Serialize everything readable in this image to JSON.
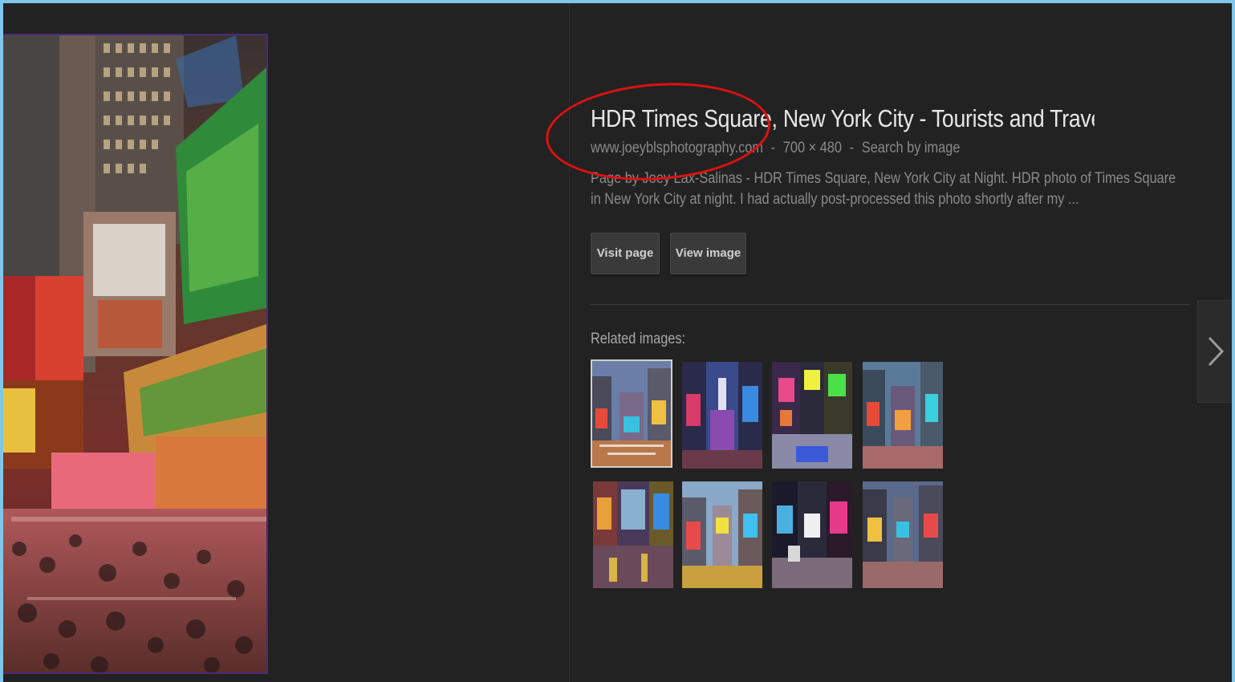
{
  "result": {
    "title": "HDR Times Square, New York City - Tourists and Traveler",
    "title_ellipsis": "...",
    "source_domain": "www.joeyblsphotography.com",
    "dimensions": "700 × 480",
    "meta_separator": "-",
    "search_by_image": "Search by image",
    "description": "Page by Joey Lax-Salinas - HDR Times Square, New York City at Night. HDR photo of Times Square in New York City at night. I had actually post-processed this photo shortly after my ..."
  },
  "buttons": {
    "visit_page": "Visit page",
    "view_image": "View image"
  },
  "related": {
    "label": "Related images:",
    "count": 8
  },
  "icons": {
    "next": "chevron-right-icon"
  },
  "colors": {
    "background": "#222222",
    "frame": "#7fc6ea",
    "annotation": "#e01010"
  }
}
